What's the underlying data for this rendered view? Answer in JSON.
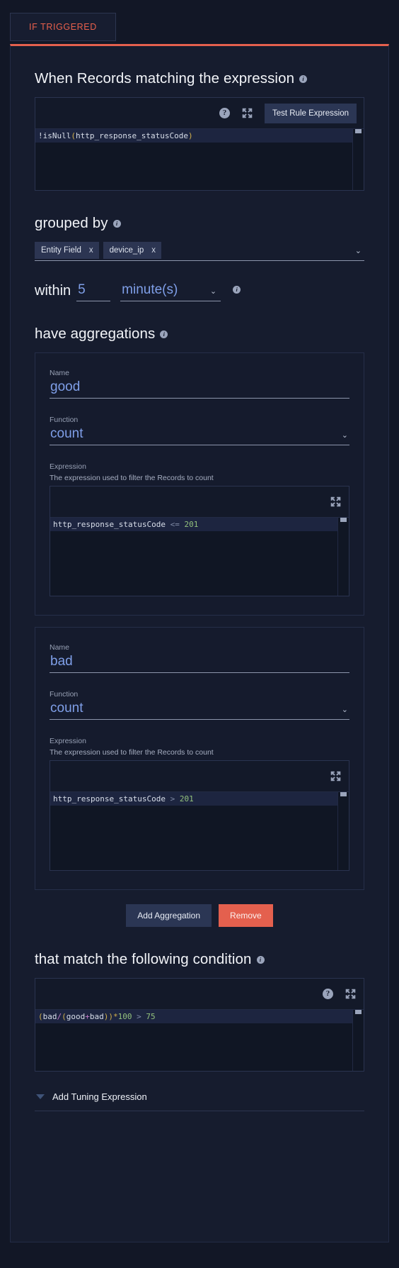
{
  "tab": {
    "label": "IF TRIGGERED"
  },
  "sections": {
    "when": {
      "title": "When Records matching the expression",
      "toolbar": {
        "help_icon": "question-mark-icon",
        "expand_icon": "expand-arrows-icon",
        "test_button": "Test Rule Expression"
      },
      "expression": {
        "full": "!isNull(http_response_statusCode)",
        "bang": "!",
        "fn": "isNull",
        "open": "(",
        "arg": "http_response_statusCode",
        "close": ")"
      }
    },
    "grouped_by": {
      "title": "grouped by",
      "chips": [
        {
          "label": "Entity Field",
          "remove": "x"
        },
        {
          "label": "device_ip",
          "remove": "x"
        }
      ],
      "caret": "chevron-down-icon"
    },
    "within": {
      "label": "within",
      "value": "5",
      "unit": "minute(s)",
      "caret": "chevron-down-icon"
    },
    "aggregations": {
      "title": "have aggregations",
      "items": [
        {
          "name_label": "Name",
          "name_value": "good",
          "function_label": "Function",
          "function_value": "count",
          "expression_label": "Expression",
          "expression_help": "The expression used to filter the Records to count",
          "expression": {
            "full": "http_response_statusCode <= 201",
            "identifier": "http_response_statusCode",
            "operator": "<=",
            "number": "201"
          },
          "expand_icon": "expand-arrows-icon"
        },
        {
          "name_label": "Name",
          "name_value": "bad",
          "function_label": "Function",
          "function_value": "count",
          "expression_label": "Expression",
          "expression_help": "The expression used to filter the Records to count",
          "expression": {
            "full": "http_response_statusCode > 201",
            "identifier": "http_response_statusCode",
            "operator": ">",
            "number": "201"
          },
          "expand_icon": "expand-arrows-icon"
        }
      ],
      "add_button": "Add Aggregation",
      "remove_button": "Remove"
    },
    "condition": {
      "title": "that match the following condition",
      "toolbar": {
        "help_icon": "question-mark-icon",
        "expand_icon": "expand-arrows-icon"
      },
      "expression": {
        "full": "(bad/(good+bad))*100 > 75",
        "p1": "(",
        "bad1": "bad",
        "slash": "/",
        "p2": "(",
        "good": "good",
        "plus": "+",
        "bad2": "bad",
        "p3": ")",
        "p4": ")",
        "star": "*",
        "hundred": "100",
        "gt": ">",
        "seventyfive": "75"
      }
    },
    "tuning": {
      "label": "Add Tuning Expression",
      "caret": "triangle-down-icon"
    }
  },
  "colors": {
    "accent_red": "#e4604e",
    "page_bg": "#121726",
    "card_bg": "#161c2e",
    "field_blue": "#7f9fe8",
    "button_blue": "#2b3654"
  }
}
